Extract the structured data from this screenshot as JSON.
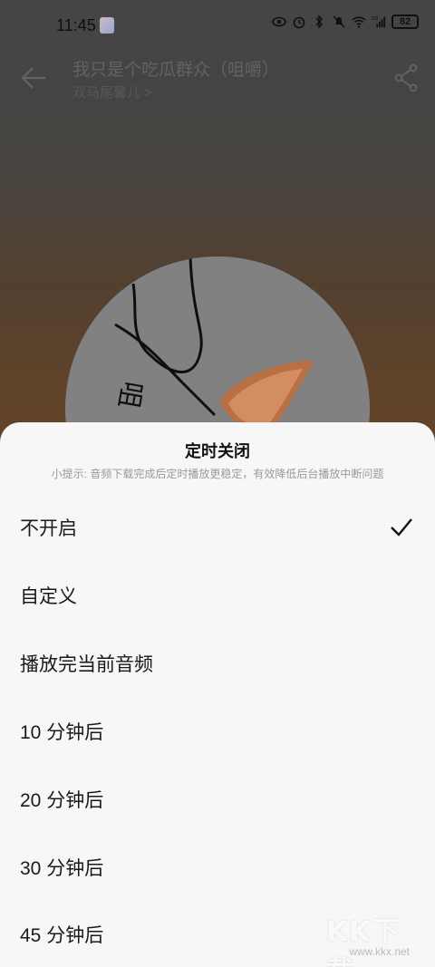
{
  "status_bar": {
    "time": "11:45",
    "battery": "82",
    "network": "5G"
  },
  "header": {
    "title": "我只是个吃瓜群众（咀嚼）",
    "artist": "双马尾馨儿 >"
  },
  "sheet": {
    "title": "定时关闭",
    "tip": "小提示: 音频下载完成后定时播放更稳定，有效降低后台播放中断问题",
    "options": [
      {
        "label": "不开启",
        "selected": true
      },
      {
        "label": "自定义",
        "selected": false
      },
      {
        "label": "播放完当前音频",
        "selected": false
      },
      {
        "label": "10 分钟后",
        "selected": false
      },
      {
        "label": "20 分钟后",
        "selected": false
      },
      {
        "label": "30 分钟后",
        "selected": false
      },
      {
        "label": "45 分钟后",
        "selected": false
      }
    ]
  },
  "watermark": {
    "logo": "KK下载",
    "url": "www.kkx.net"
  },
  "icons": {
    "back": "arrow-left-icon",
    "share": "share-icon",
    "check": "check-icon"
  }
}
